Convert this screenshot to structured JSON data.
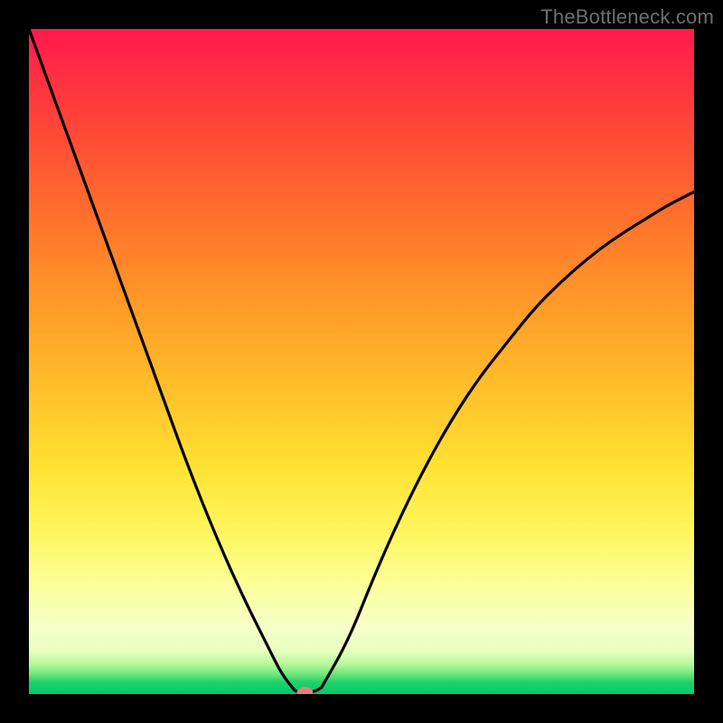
{
  "watermark": "TheBottleneck.com",
  "chart_data": {
    "type": "line",
    "title": "",
    "xlabel": "",
    "ylabel": "",
    "xlim": [
      0,
      100
    ],
    "ylim": [
      0,
      100
    ],
    "grid": false,
    "legend": false,
    "background": {
      "type": "vertical-gradient",
      "stops": [
        {
          "pos": 0,
          "color": "#ff1a4d"
        },
        {
          "pos": 12,
          "color": "#ff3e3a"
        },
        {
          "pos": 26,
          "color": "#ff6a2e"
        },
        {
          "pos": 40,
          "color": "#ff9628"
        },
        {
          "pos": 54,
          "color": "#ffbf2a"
        },
        {
          "pos": 66,
          "color": "#ffe233"
        },
        {
          "pos": 76,
          "color": "#fff760"
        },
        {
          "pos": 84,
          "color": "#fbff9e"
        },
        {
          "pos": 90,
          "color": "#f6ffc9"
        },
        {
          "pos": 93.5,
          "color": "#e8ffbf"
        },
        {
          "pos": 95.5,
          "color": "#b8f79a"
        },
        {
          "pos": 97,
          "color": "#6ee87a"
        },
        {
          "pos": 98.2,
          "color": "#21d16a"
        },
        {
          "pos": 100,
          "color": "#00c96e"
        }
      ]
    },
    "series": [
      {
        "name": "left-branch",
        "x": [
          0,
          4,
          8,
          12,
          16,
          20,
          24,
          28,
          32,
          36,
          38,
          40
        ],
        "y": [
          100,
          89,
          78,
          67,
          56,
          45,
          34,
          24,
          15,
          7,
          3,
          0.5
        ]
      },
      {
        "name": "valley-floor",
        "x": [
          40,
          41,
          42,
          43,
          44
        ],
        "y": [
          0.5,
          0.3,
          0.3,
          0.4,
          1
        ]
      },
      {
        "name": "right-branch",
        "x": [
          44,
          48,
          52,
          56,
          60,
          64,
          68,
          72,
          76,
          80,
          84,
          88,
          92,
          96,
          100
        ],
        "y": [
          1,
          8,
          18,
          27,
          35,
          42,
          48,
          53,
          58,
          62,
          65.5,
          68.5,
          71,
          73.5,
          75.5
        ]
      }
    ],
    "marker": {
      "name": "valley-marker",
      "x": 41.5,
      "y": 0.3,
      "color": "#d98480",
      "rx": 1.2,
      "ry": 0.8
    }
  }
}
